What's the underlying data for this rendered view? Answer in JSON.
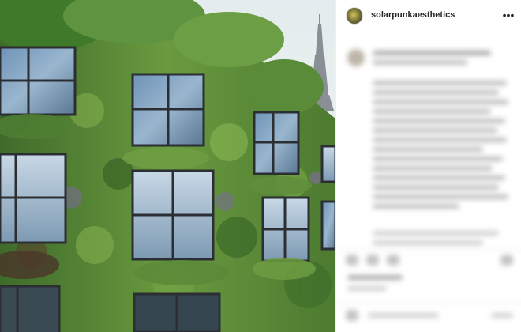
{
  "post": {
    "username": "solarpunkaesthetics",
    "more_icon": "more-horizontal-icon",
    "image_subject": "green-wall-building-photo"
  },
  "colors": {
    "text": "#262626",
    "border": "#efefef",
    "foliage": "#5d8a3a"
  }
}
